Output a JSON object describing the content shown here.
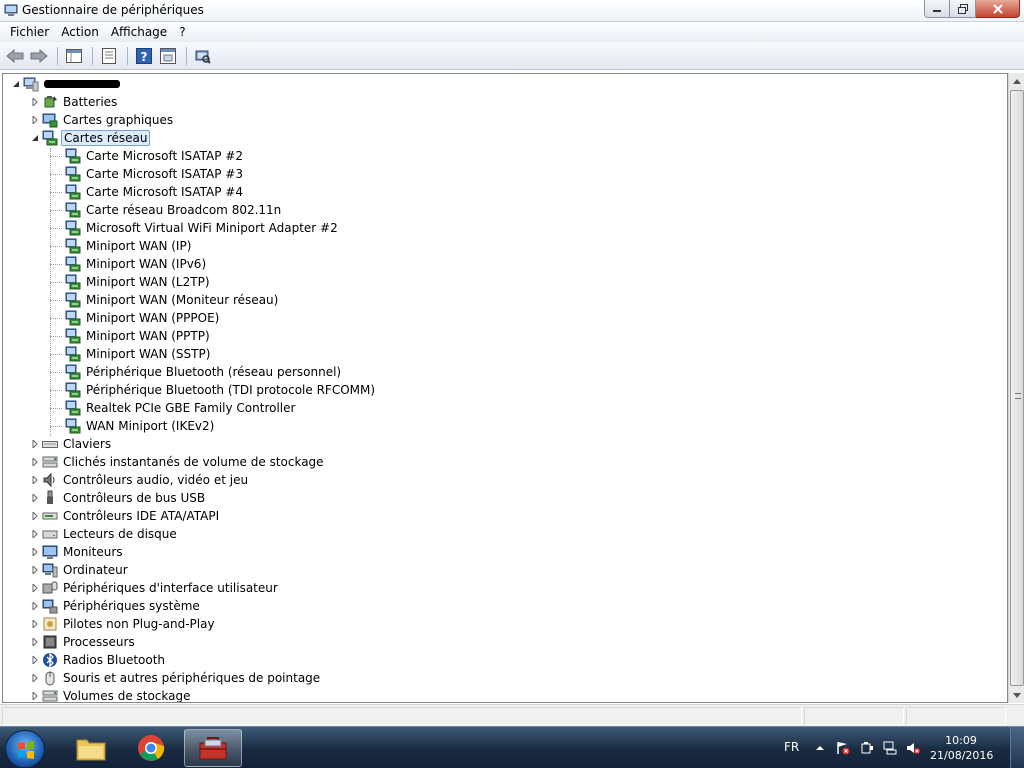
{
  "window": {
    "title": "Gestionnaire de périphériques"
  },
  "menu": [
    "Fichier",
    "Action",
    "Affichage",
    "?"
  ],
  "toolbar": {
    "buttons": [
      "back-icon",
      "forward-icon",
      "properties-pane-icon",
      "properties-icon",
      "help-icon",
      "update-driver-icon",
      "scan-hardware-icon"
    ]
  },
  "tree": {
    "categories": [
      {
        "label": "Batteries",
        "icon": "battery-icon"
      },
      {
        "label": "Cartes graphiques",
        "icon": "display-adapter-icon"
      },
      {
        "label": "Cartes réseau",
        "icon": "network-adapter-icon",
        "expanded": true,
        "children": [
          "Carte Microsoft ISATAP #2",
          "Carte Microsoft ISATAP #3",
          "Carte Microsoft ISATAP #4",
          "Carte réseau Broadcom 802.11n",
          "Microsoft Virtual WiFi Miniport Adapter #2",
          "Miniport WAN (IP)",
          "Miniport WAN (IPv6)",
          "Miniport WAN (L2TP)",
          "Miniport WAN (Moniteur réseau)",
          "Miniport WAN (PPPOE)",
          "Miniport WAN (PPTP)",
          "Miniport WAN (SSTP)",
          "Périphérique Bluetooth (réseau personnel)",
          "Périphérique Bluetooth (TDI protocole RFCOMM)",
          "Realtek PCIe GBE Family Controller",
          "WAN Miniport (IKEv2)"
        ]
      },
      {
        "label": "Claviers",
        "icon": "keyboard-icon"
      },
      {
        "label": "Clichés instantanés de volume de stockage",
        "icon": "storage-volume-icon"
      },
      {
        "label": "Contrôleurs audio, vidéo et jeu",
        "icon": "speaker-icon"
      },
      {
        "label": "Contrôleurs de bus USB",
        "icon": "usb-icon"
      },
      {
        "label": "Contrôleurs IDE ATA/ATAPI",
        "icon": "ide-controller-icon"
      },
      {
        "label": "Lecteurs de disque",
        "icon": "disk-drive-icon"
      },
      {
        "label": "Moniteurs",
        "icon": "monitor-icon"
      },
      {
        "label": "Ordinateur",
        "icon": "computer-icon"
      },
      {
        "label": "Périphériques d'interface utilisateur",
        "icon": "hid-icon"
      },
      {
        "label": "Périphériques système",
        "icon": "system-device-icon"
      },
      {
        "label": "Pilotes non Plug-and-Play",
        "icon": "non-pnp-driver-icon"
      },
      {
        "label": "Processeurs",
        "icon": "processor-icon"
      },
      {
        "label": "Radios Bluetooth",
        "icon": "bluetooth-icon"
      },
      {
        "label": "Souris et autres périphériques de pointage",
        "icon": "mouse-icon"
      },
      {
        "label": "Volumes de stockage",
        "icon": "storage-volume-icon"
      }
    ]
  },
  "taskbar": {
    "language": "FR",
    "time": "10:09",
    "date": "21/08/2016",
    "apps": [
      "folder-icon",
      "chrome-icon",
      "toolbox-icon"
    ]
  }
}
